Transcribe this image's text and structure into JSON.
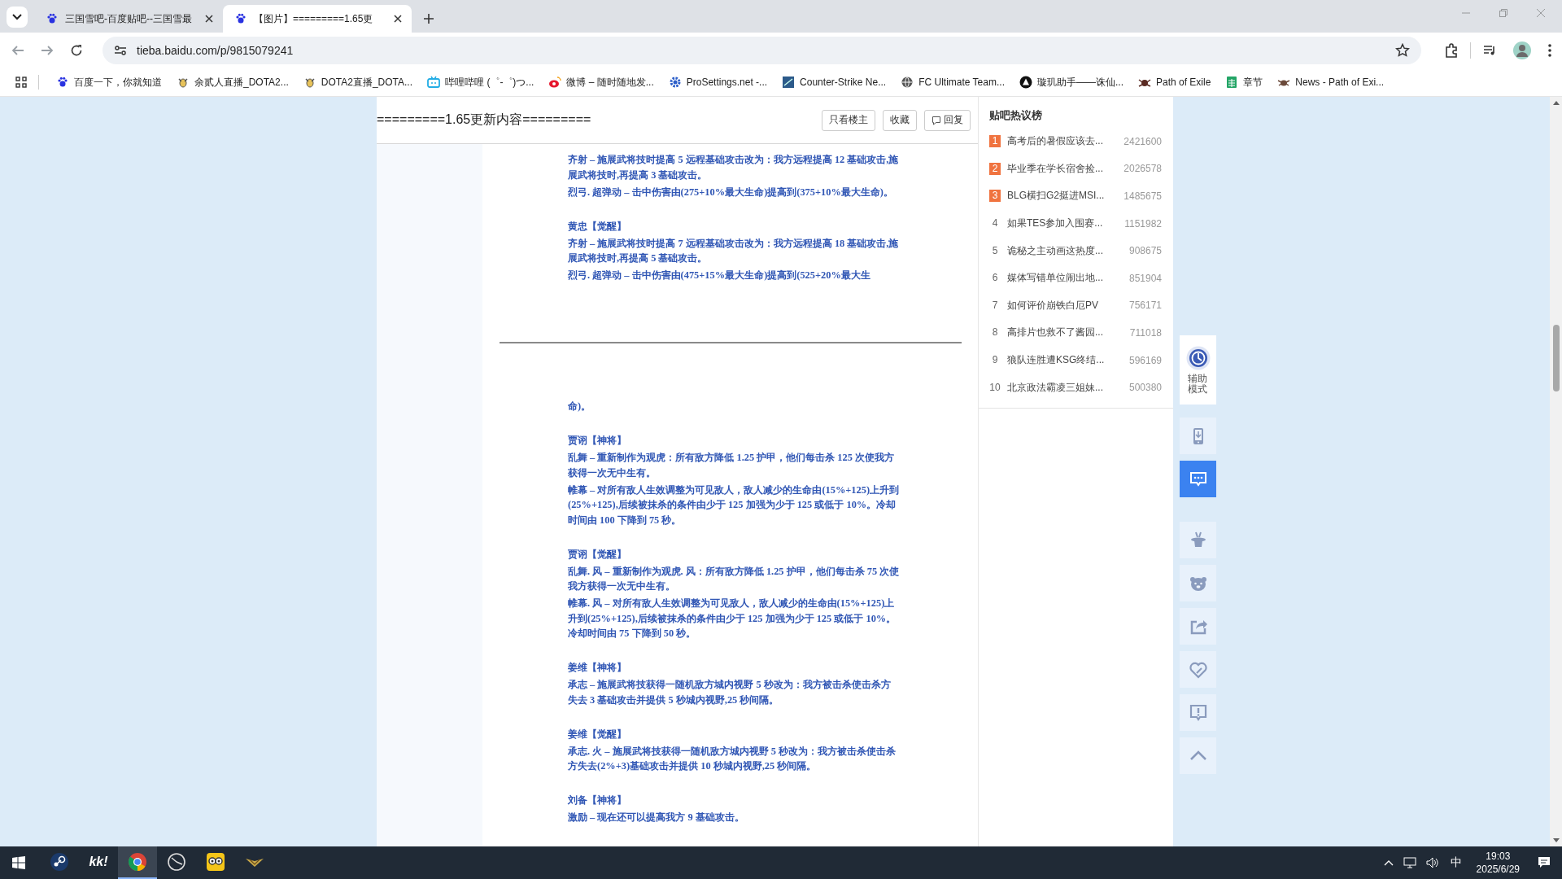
{
  "browser": {
    "tabs": [
      {
        "title": "三国雪吧-百度贴吧--三国雪最",
        "selected": false
      },
      {
        "title": "【图片】=========1.65更",
        "selected": true
      }
    ],
    "address": "tieba.baidu.com/p/9815079241",
    "bookmarks": [
      "百度一下，你就知道",
      "余贰人直播_DOTA2...",
      "DOTA2直播_DOTA...",
      "哔哩哔哩 (゜-゜)つ...",
      "微博 – 随时随地发...",
      "ProSettings.net -...",
      "Counter-Strike Ne...",
      "FC Ultimate Team...",
      "璇玑助手——诛仙...",
      "Path of Exile",
      "章节",
      "News - Path of Exi..."
    ]
  },
  "post": {
    "title": "=========1.65更新内容=========",
    "buttons": [
      {
        "kind": "plain",
        "label": "只看楼主"
      },
      {
        "kind": "plain",
        "label": "收藏"
      },
      {
        "kind": "reply",
        "label": "回复"
      }
    ],
    "images": [
      {
        "blocks": [
          {
            "paragraphs": [
              "齐射 – 施展武将技时提高 5 远程基础攻击改为：我方远程提高 12 基础攻击,施展武将技时,再提高 3 基础攻击。",
              "烈弓. 超弹动 – 击中伤害由(275+10%最大生命)提高到(375+10%最大生命)。"
            ]
          },
          {
            "heading": "黄忠【觉醒】",
            "paragraphs": [
              "齐射 – 施展武将技时提高 7 远程基础攻击改为：我方远程提高 18 基础攻击,施展武将技时,再提高 5 基础攻击。",
              "烈弓. 超弹动 – 击中伤害由(475+15%最大生命)提高到(525+20%最大生"
            ]
          }
        ]
      },
      {
        "blocks": [
          {
            "paragraphs": [
              "命)。"
            ]
          },
          {
            "heading": "贾诩【神将】",
            "paragraphs": [
              "乱舞 – 重新制作为观虎：所有敌方降低 1.25 护甲，他们每击杀 125 次使我方获得一次无中生有。",
              "帷幕 – 对所有敌人生效调整为可见敌人，敌人减少的生命由(15%+125)上升到(25%+125),后续被抹杀的条件由少于 125 加强为少于 125 或低于 10%。冷却时间由 100 下降到 75 秒。"
            ]
          },
          {
            "heading": "贾诩【觉醒】",
            "paragraphs": [
              "乱舞. 风 – 重新制作为观虎. 风：所有敌方降低 1.25 护甲，他们每击杀 75 次使我方获得一次无中生有。",
              "帷幕. 风 – 对所有敌人生效调整为可见敌人，敌人减少的生命由(15%+125)上升到(25%+125),后续被抹杀的条件由少于 125 加强为少于 125 或低于 10%。冷却时间由 75 下降到 50 秒。"
            ]
          },
          {
            "heading": "姜维【神将】",
            "paragraphs": [
              "承志 – 施展武将技获得一随机敌方城内视野 5 秒改为：我方被击杀使击杀方失去 3 基础攻击并提供 5 秒城内视野,25 秒间隔。"
            ]
          },
          {
            "heading": "姜维【觉醒】",
            "paragraphs": [
              "承志. 火 – 施展武将技获得一随机敌方城内视野 5 秒改为：我方被击杀使击杀方失去(2%+3)基础攻击并提供 10 秒城内视野,25 秒间隔。"
            ]
          },
          {
            "heading": "刘备【神将】",
            "paragraphs": [
              "激励 – 现在还可以提高我方 9 基础攻击。"
            ]
          }
        ]
      }
    ]
  },
  "hot_list": {
    "title": "贴吧热议榜",
    "items": [
      {
        "rank": "1",
        "title": "高考后的暑假应该去...",
        "count": "2421600",
        "highlighted": true
      },
      {
        "rank": "2",
        "title": "毕业季在学长宿舍捡...",
        "count": "2026578",
        "highlighted": true
      },
      {
        "rank": "3",
        "title": "BLG横扫G2挺进MSI...",
        "count": "1485675",
        "highlighted": true
      },
      {
        "rank": "4",
        "title": "如果TES参加入围赛...",
        "count": "1151982",
        "highlighted": false
      },
      {
        "rank": "5",
        "title": "诡秘之主动画这热度...",
        "count": "908675",
        "highlighted": false
      },
      {
        "rank": "6",
        "title": "媒体写错单位闹出地...",
        "count": "851904",
        "highlighted": false
      },
      {
        "rank": "7",
        "title": "如何评价崩铁白厄PV",
        "count": "756171",
        "highlighted": false
      },
      {
        "rank": "8",
        "title": "高排片也救不了酱园...",
        "count": "711018",
        "highlighted": false
      },
      {
        "rank": "9",
        "title": "狼队连胜遭KSG终结...",
        "count": "596169",
        "highlighted": false
      },
      {
        "rank": "10",
        "title": "北京政法霸凌三姐妹...",
        "count": "500380",
        "highlighted": false
      }
    ]
  },
  "side_tools": [
    {
      "kind": "assist",
      "label": "辅助模式"
    },
    {
      "kind": "download",
      "selected": false
    },
    {
      "kind": "chat",
      "selected": true
    },
    {
      "kind": "hat",
      "selected": false
    },
    {
      "kind": "bear",
      "selected": false
    },
    {
      "kind": "share",
      "selected": false
    },
    {
      "kind": "heart",
      "selected": false
    },
    {
      "kind": "report",
      "selected": false
    },
    {
      "kind": "top",
      "selected": false
    }
  ],
  "taskbar": {
    "apps": [
      {
        "kind": "steam",
        "active": false
      },
      {
        "kind": "kk",
        "label": "kk!",
        "active": false
      },
      {
        "kind": "chrome",
        "active": true
      },
      {
        "kind": "dial",
        "active": false
      },
      {
        "kind": "owl",
        "active": false
      },
      {
        "kind": "wing",
        "active": false
      }
    ],
    "ime": "中",
    "time": "19:03",
    "date": "2025/6/29"
  }
}
